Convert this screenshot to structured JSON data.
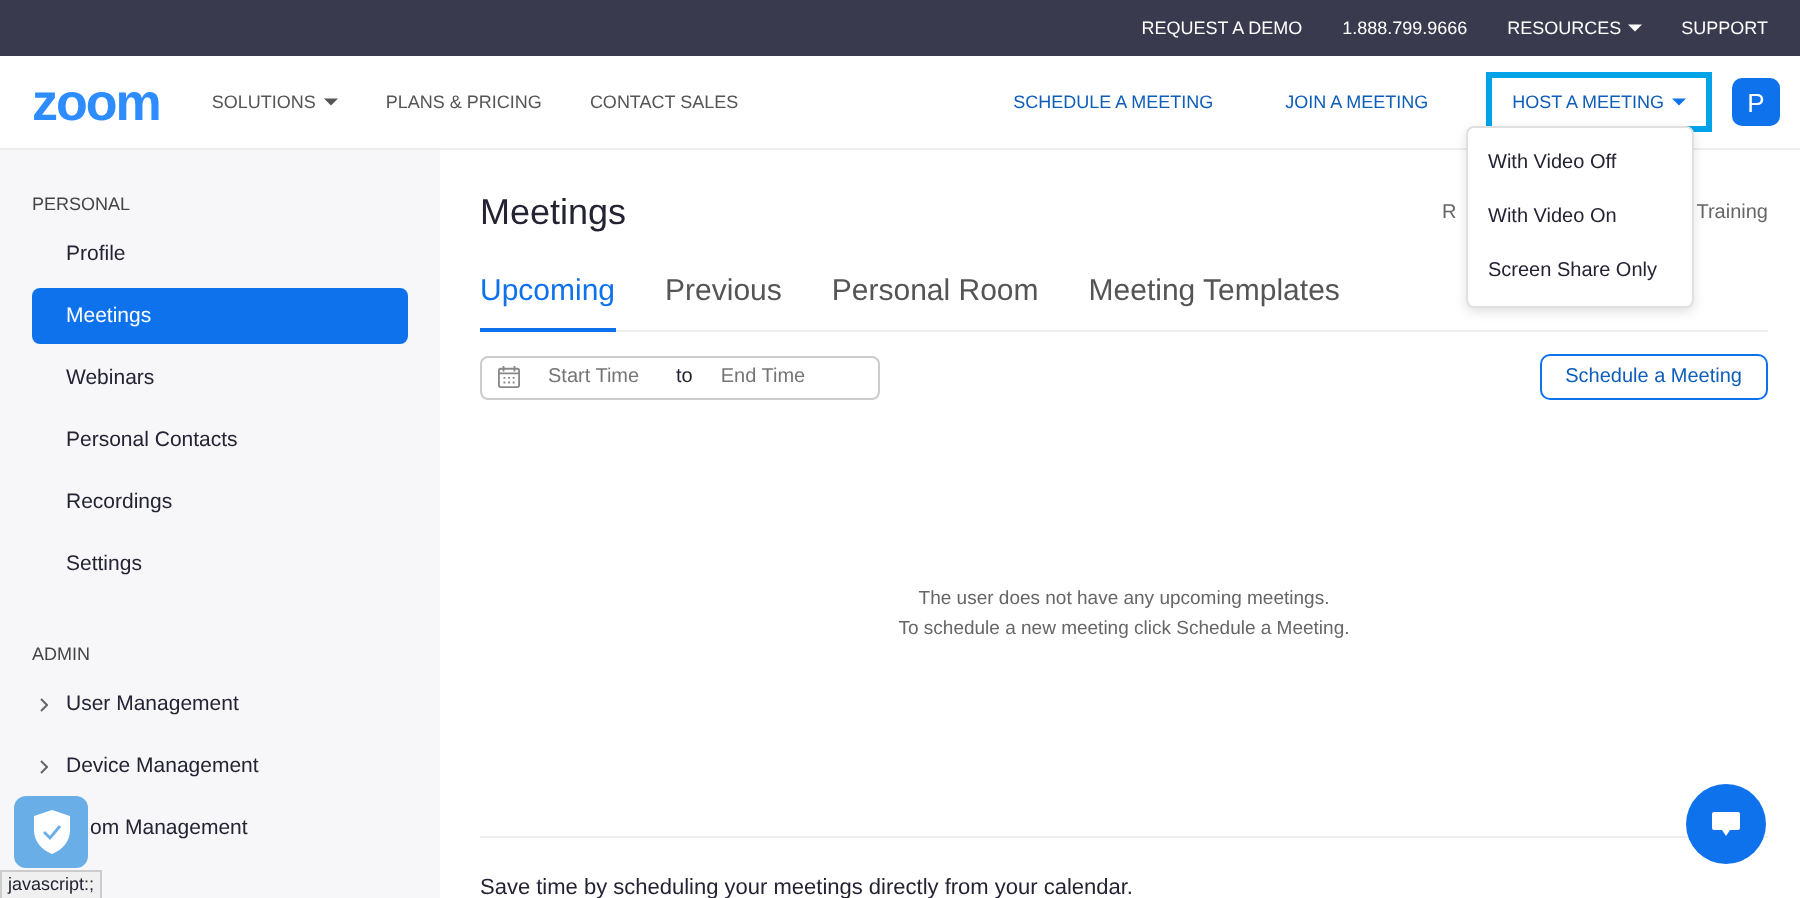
{
  "top_bar": {
    "links": [
      {
        "label": "REQUEST A DEMO",
        "caret": false
      },
      {
        "label": "1.888.799.9666",
        "caret": false
      },
      {
        "label": "RESOURCES",
        "caret": true
      },
      {
        "label": "SUPPORT",
        "caret": false
      }
    ]
  },
  "nav": {
    "logo": "zoom",
    "links": [
      {
        "label": "SOLUTIONS",
        "caret": true
      },
      {
        "label": "PLANS & PRICING",
        "caret": false
      },
      {
        "label": "CONTACT SALES",
        "caret": false
      }
    ],
    "actions": [
      {
        "label": "SCHEDULE A MEETING",
        "caret": false,
        "selected": false
      },
      {
        "label": "JOIN A MEETING",
        "caret": false,
        "selected": false
      },
      {
        "label": "HOST A MEETING",
        "caret": true,
        "selected": true
      }
    ],
    "avatar": "P"
  },
  "host_menu": [
    "With Video Off",
    "With Video On",
    "Screen Share Only"
  ],
  "sidebar": {
    "sections": [
      {
        "title": "PERSONAL",
        "items": [
          {
            "label": "Profile",
            "selected": false,
            "expandable": false
          },
          {
            "label": "Meetings",
            "selected": true,
            "expandable": false
          },
          {
            "label": "Webinars",
            "selected": false,
            "expandable": false
          },
          {
            "label": "Personal Contacts",
            "selected": false,
            "expandable": false
          },
          {
            "label": "Recordings",
            "selected": false,
            "expandable": false
          },
          {
            "label": "Settings",
            "selected": false,
            "expandable": false
          }
        ]
      },
      {
        "title": "ADMIN",
        "items": [
          {
            "label": "User Management",
            "selected": false,
            "expandable": true
          },
          {
            "label": "Device Management",
            "selected": false,
            "expandable": true
          },
          {
            "label": "om Management",
            "selected": false,
            "expandable": false
          }
        ]
      }
    ]
  },
  "main": {
    "title": "Meetings",
    "header_fragments": [
      "R",
      "Training"
    ],
    "tabs": [
      {
        "label": "Upcoming",
        "selected": true
      },
      {
        "label": "Previous",
        "selected": false
      },
      {
        "label": "Personal Room",
        "selected": false
      },
      {
        "label": "Meeting Templates",
        "selected": false
      }
    ],
    "date_range": {
      "start_placeholder": "Start Time",
      "separator": "to",
      "end_placeholder": "End Time"
    },
    "schedule_button": "Schedule a Meeting",
    "empty_message": [
      "The user does not have any upcoming meetings.",
      "To schedule a new meeting click Schedule a Meeting."
    ],
    "footer_text": "Save time by scheduling your meetings directly from your calendar."
  },
  "status_url": "javascript:;"
}
